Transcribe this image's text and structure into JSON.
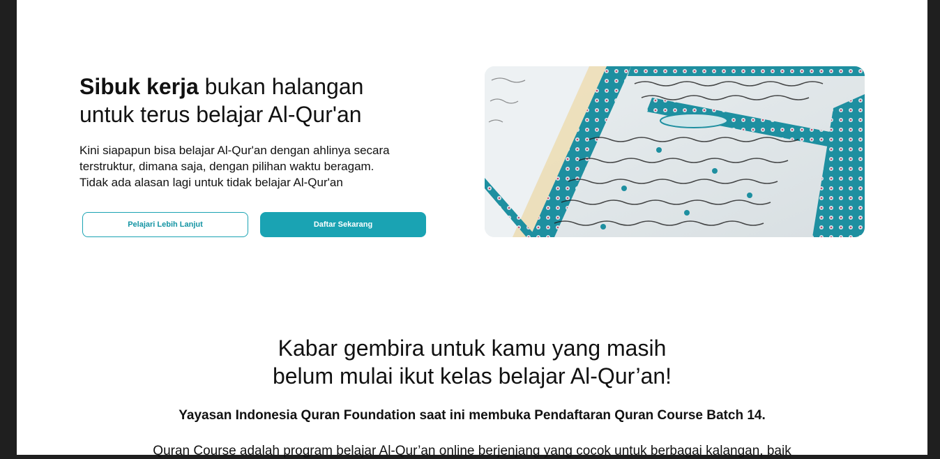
{
  "hero": {
    "title_bold": "Sibuk kerja",
    "title_rest_line1": " bukan halangan",
    "title_line2": "untuk terus belajar Al-Qur'an",
    "description_line1": "Kini siapapun bisa belajar Al-Qur'an dengan ahlinya secara",
    "description_line2": "terstruktur, dimana saja, dengan pilihan waktu beragam.",
    "description_line3": "Tidak ada alasan lagi untuk tidak belajar Al-Qur'an",
    "btn_learn_more": "Pelajari Lebih Lanjut",
    "btn_register": "Daftar Sekarang",
    "accent_color": "#1aa3b3"
  },
  "announcement": {
    "heading_line1": "Kabar gembira untuk kamu yang masih",
    "heading_line2": "belum mulai ikut kelas belajar Al-Qur’an!",
    "subheading": "Yayasan Indonesia Quran Foundation saat ini membuka Pendaftaran Quran Course Batch 14.",
    "paragraph_partial": "Quran Course adalah program belajar Al-Qur’an online berjenjang yang cocok untuk berbagai kalangan, baik"
  }
}
